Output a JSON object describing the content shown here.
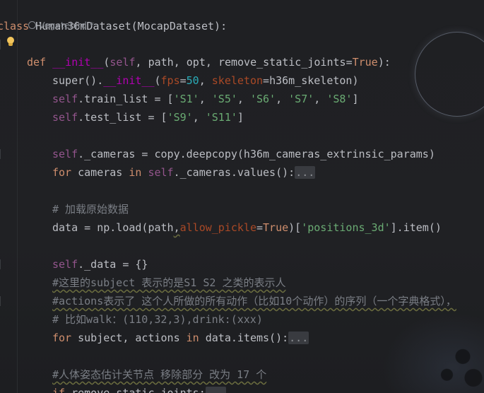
{
  "author": "Vegetebird *",
  "code_lines": {
    "l0": {
      "kw": "class",
      "rest": " Human36mDataset(MocapDataset):"
    },
    "l2": {
      "kw": "def",
      "name": "__init__",
      "open": "(",
      "self": "self",
      "mid": ", path, opt, ",
      "param": "remove_static_joints",
      "eq": "=",
      "val": "True",
      "close": "):"
    },
    "l3": {
      "a": "super().",
      "name": "__init__",
      "b": "(",
      "p1": "fps",
      "eq1": "=",
      "n1": "50",
      "c": ", ",
      "p2": "skeleton",
      "eq2": "=",
      "d": "h36m_skeleton)"
    },
    "l4": {
      "self": "self",
      "a": ".train_list = [",
      "s1": "'S1'",
      "s2": "'S5'",
      "s3": "'S6'",
      "s4": "'S7'",
      "s5": "'S8'",
      "sep": ", ",
      "close": "]"
    },
    "l5": {
      "self": "self",
      "a": ".test_list = [",
      "s1": "'S9'",
      "s2": "'S11'",
      "sep": ", ",
      "close": "]"
    },
    "l7": {
      "self": "self",
      "a": "._cameras = copy.deepcopy(h36m_cameras_extrinsic_params)"
    },
    "l8": {
      "kw1": "for",
      "a": " cameras ",
      "kw2": "in",
      "self": " self",
      "b": "._cameras.values():",
      "fold": "..."
    },
    "l10": {
      "comment": "# 加载原始数据"
    },
    "l11": {
      "a": "data = np.load(path",
      "comma": ",",
      "param": "allow_pickle",
      "eq": "=",
      "val": "True",
      "b": ")[",
      "str": "'positions_3d'",
      "c": "].item()"
    },
    "l13": {
      "self": "self",
      "a": "._data = {}"
    },
    "l14": {
      "comment": "#这里的subject 表示的是S1 S2 之类的表示人"
    },
    "l15": {
      "comment": "#actions表示了 这个人所做的所有动作（比如10个动作）的序列（一个字典格式），"
    },
    "l16": {
      "comment": "# 比如walk：(110,32,3),drink:(xxx)"
    },
    "l17": {
      "kw1": "for",
      "a": " subject, actions ",
      "kw2": "in",
      "b": " data.items():",
      "fold": "..."
    },
    "l19": {
      "comment": "#人体姿态估计关节点 移除部分 改为 17 个"
    },
    "l20": {
      "kw": "if",
      "a": " remove_static_joints:",
      "fold": "..."
    }
  }
}
